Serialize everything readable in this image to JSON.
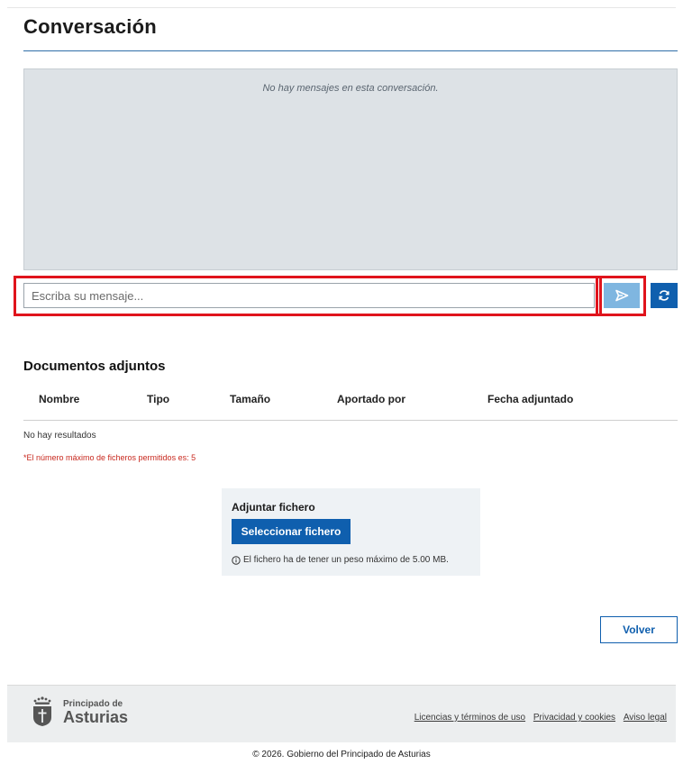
{
  "header": {
    "title": "Conversación"
  },
  "chat": {
    "empty_text": "No hay mensajes en esta conversación.",
    "input_placeholder": "Escriba su mensaje...",
    "send_icon": "send-icon",
    "refresh_icon": "refresh-icon"
  },
  "attachments": {
    "title": "Documentos adjuntos",
    "columns": [
      "Nombre",
      "Tipo",
      "Tamaño",
      "Aportado por",
      "Fecha adjuntado"
    ],
    "no_results": "No hay resultados",
    "max_files_note": "*El número máximo de ficheros permitidos es: 5"
  },
  "upload": {
    "label": "Adjuntar fichero",
    "button_label": "Seleccionar fichero",
    "size_note": "El fichero ha de tener un peso máximo de 5.00 MB."
  },
  "actions": {
    "back_label": "Volver"
  },
  "footer": {
    "logo_small": "Principado de",
    "logo_big": "Asturias",
    "links": [
      "Licencias y términos de uso",
      "Privacidad y cookies",
      "Aviso legal"
    ],
    "copyright": "© 2026. Gobierno del Principado de Asturias"
  },
  "colors": {
    "primary": "#0f5fae",
    "send_button": "#7fb6e0",
    "highlight": "#e0141c",
    "chat_background": "#dde2e6",
    "warning_text": "#c8281e"
  }
}
